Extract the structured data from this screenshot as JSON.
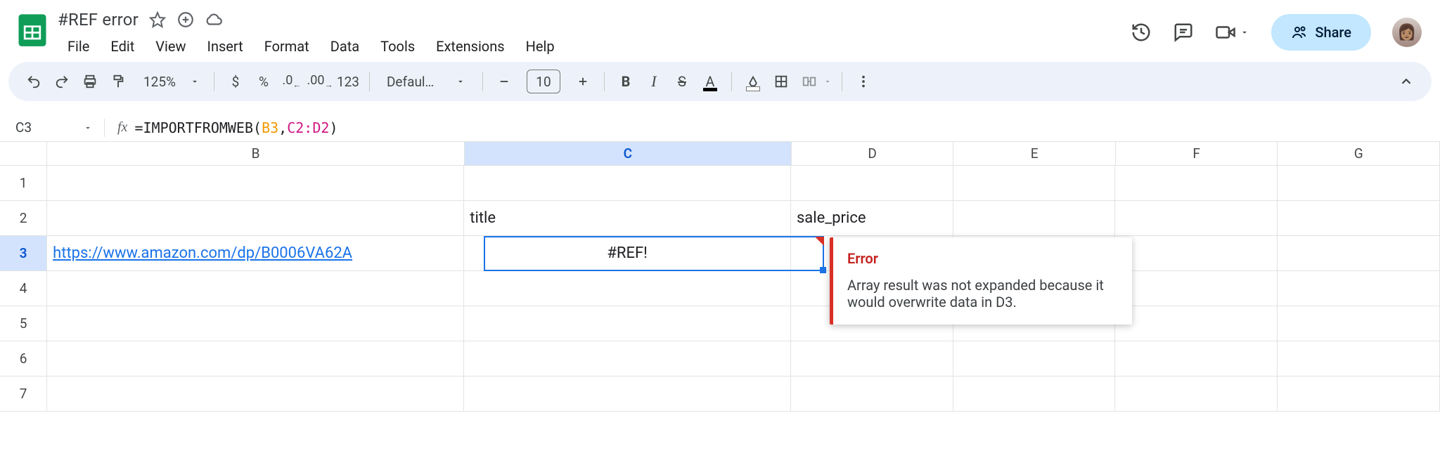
{
  "header": {
    "doc_title": "#REF error",
    "menus": [
      "File",
      "Edit",
      "View",
      "Insert",
      "Format",
      "Data",
      "Tools",
      "Extensions",
      "Help"
    ],
    "share_label": "Share"
  },
  "toolbar": {
    "zoom": "125%",
    "currency": "$",
    "percent": "%",
    "dec_dec": ".0",
    "inc_dec": ".00",
    "num_fmt": "123",
    "font_name": "Defaul…",
    "font_size": "10",
    "bold": "B",
    "italic": "I",
    "text_color": "A"
  },
  "name_box": "C3",
  "formula": {
    "fn": "IMPORTFROMWEB",
    "arg1": "B3",
    "arg2": "C2:D2"
  },
  "columns": [
    "B",
    "C",
    "D",
    "E",
    "F",
    "G"
  ],
  "row_numbers": [
    "1",
    "2",
    "3",
    "4",
    "5",
    "6",
    "7"
  ],
  "cells": {
    "C2": "title",
    "D2": "sale_price",
    "B3": "https://www.amazon.com/dp/B0006VA62A",
    "C3": "#REF!"
  },
  "tooltip": {
    "title": "Error",
    "body": "Array result was not expanded because it would overwrite data in D3."
  }
}
